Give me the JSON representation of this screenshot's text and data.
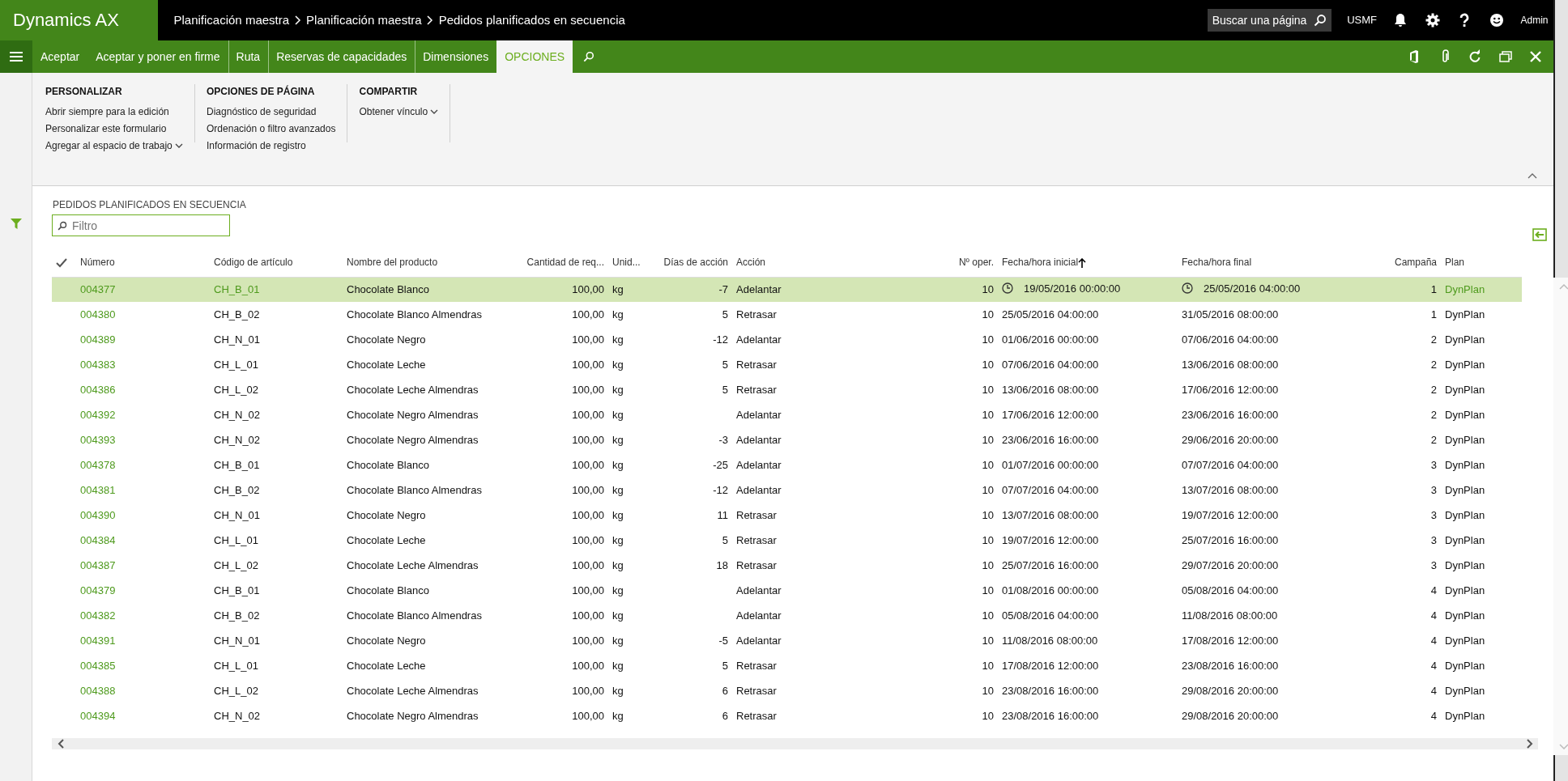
{
  "app": {
    "title": "Dynamics AX"
  },
  "breadcrumb": [
    "Planificación maestra",
    "Planificación maestra",
    "Pedidos planificados en secuencia"
  ],
  "search": {
    "placeholder": "Buscar una página"
  },
  "company": "USMF",
  "user": "Admin",
  "actions": [
    {
      "label": "Aceptar",
      "separator_before": false,
      "selected": false
    },
    {
      "label": "Aceptar y poner en firme",
      "separator_before": false,
      "selected": false
    },
    {
      "label": "Ruta",
      "separator_before": true,
      "selected": false
    },
    {
      "label": "Reservas de capacidades",
      "separator_before": true,
      "selected": false
    },
    {
      "label": "Dimensiones",
      "separator_before": true,
      "selected": false
    },
    {
      "label": "OPCIONES",
      "separator_before": false,
      "selected": true
    }
  ],
  "option_groups": [
    {
      "title": "PERSONALIZAR",
      "items": [
        {
          "label": "Abrir siempre para la edición",
          "dropdown": false
        },
        {
          "label": "Personalizar este formulario",
          "dropdown": false
        },
        {
          "label": "Agregar al espacio de trabajo",
          "dropdown": true
        }
      ]
    },
    {
      "title": "OPCIONES DE PÁGINA",
      "items": [
        {
          "label": "Diagnóstico de seguridad",
          "dropdown": false
        },
        {
          "label": "Ordenación o filtro avanzados",
          "dropdown": false
        },
        {
          "label": "Información de registro",
          "dropdown": false
        }
      ]
    },
    {
      "title": "COMPARTIR",
      "items": [
        {
          "label": "Obtener vínculo",
          "dropdown": true
        }
      ]
    }
  ],
  "grid": {
    "title": "PEDIDOS PLANIFICADOS EN SECUENCIA",
    "filter": {
      "placeholder": "Filtro"
    },
    "columns": [
      {
        "label": "Número",
        "sorted": false
      },
      {
        "label": "Código de artículo",
        "sorted": false
      },
      {
        "label": "Nombre del producto",
        "sorted": false
      },
      {
        "label": "Cantidad de req...",
        "sorted": false
      },
      {
        "label": "Unid...",
        "sorted": false
      },
      {
        "label": "Días de acción",
        "sorted": false
      },
      {
        "label": "Acción",
        "sorted": false
      },
      {
        "label": "Nº oper.",
        "sorted": false
      },
      {
        "label": "Fecha/hora inicial",
        "sorted": true
      },
      {
        "label": "Fecha/hora final",
        "sorted": false
      },
      {
        "label": "Campaña",
        "sorted": false
      },
      {
        "label": "Plan",
        "sorted": false
      }
    ],
    "rows": [
      {
        "selected": true,
        "cells": [
          "004377",
          "CH_B_01",
          "Chocolate Blanco",
          "100,00",
          "kg",
          "-7",
          "Adelantar",
          "10",
          "19/05/2016 00:00:00",
          "25/05/2016 04:00:00",
          "1",
          "DynPlan"
        ]
      },
      {
        "selected": false,
        "cells": [
          "004380",
          "CH_B_02",
          "Chocolate Blanco Almendras",
          "100,00",
          "kg",
          "5",
          "Retrasar",
          "10",
          "25/05/2016 04:00:00",
          "31/05/2016 08:00:00",
          "1",
          "DynPlan"
        ]
      },
      {
        "selected": false,
        "cells": [
          "004389",
          "CH_N_01",
          "Chocolate Negro",
          "100,00",
          "kg",
          "-12",
          "Adelantar",
          "10",
          "01/06/2016 00:00:00",
          "07/06/2016 04:00:00",
          "2",
          "DynPlan"
        ]
      },
      {
        "selected": false,
        "cells": [
          "004383",
          "CH_L_01",
          "Chocolate Leche",
          "100,00",
          "kg",
          "5",
          "Retrasar",
          "10",
          "07/06/2016 04:00:00",
          "13/06/2016 08:00:00",
          "2",
          "DynPlan"
        ]
      },
      {
        "selected": false,
        "cells": [
          "004386",
          "CH_L_02",
          "Chocolate Leche Almendras",
          "100,00",
          "kg",
          "5",
          "Retrasar",
          "10",
          "13/06/2016 08:00:00",
          "17/06/2016 12:00:00",
          "2",
          "DynPlan"
        ]
      },
      {
        "selected": false,
        "cells": [
          "004392",
          "CH_N_02",
          "Chocolate Negro Almendras",
          "100,00",
          "kg",
          null,
          "Adelantar",
          "10",
          "17/06/2016 12:00:00",
          "23/06/2016 16:00:00",
          "2",
          "DynPlan"
        ]
      },
      {
        "selected": false,
        "cells": [
          "004393",
          "CH_N_02",
          "Chocolate Negro Almendras",
          "100,00",
          "kg",
          "-3",
          "Adelantar",
          "10",
          "23/06/2016 16:00:00",
          "29/06/2016 20:00:00",
          "2",
          "DynPlan"
        ]
      },
      {
        "selected": false,
        "cells": [
          "004378",
          "CH_B_01",
          "Chocolate Blanco",
          "100,00",
          "kg",
          "-25",
          "Adelantar",
          "10",
          "01/07/2016 00:00:00",
          "07/07/2016 04:00:00",
          "3",
          "DynPlan"
        ]
      },
      {
        "selected": false,
        "cells": [
          "004381",
          "CH_B_02",
          "Chocolate Blanco Almendras",
          "100,00",
          "kg",
          "-12",
          "Adelantar",
          "10",
          "07/07/2016 04:00:00",
          "13/07/2016 08:00:00",
          "3",
          "DynPlan"
        ]
      },
      {
        "selected": false,
        "cells": [
          "004390",
          "CH_N_01",
          "Chocolate Negro",
          "100,00",
          "kg",
          "11",
          "Retrasar",
          "10",
          "13/07/2016 08:00:00",
          "19/07/2016 12:00:00",
          "3",
          "DynPlan"
        ]
      },
      {
        "selected": false,
        "cells": [
          "004384",
          "CH_L_01",
          "Chocolate Leche",
          "100,00",
          "kg",
          "5",
          "Retrasar",
          "10",
          "19/07/2016 12:00:00",
          "25/07/2016 16:00:00",
          "3",
          "DynPlan"
        ]
      },
      {
        "selected": false,
        "cells": [
          "004387",
          "CH_L_02",
          "Chocolate Leche Almendras",
          "100,00",
          "kg",
          "18",
          "Retrasar",
          "10",
          "25/07/2016 16:00:00",
          "29/07/2016 20:00:00",
          "3",
          "DynPlan"
        ]
      },
      {
        "selected": false,
        "cells": [
          "004379",
          "CH_B_01",
          "Chocolate Blanco",
          "100,00",
          "kg",
          null,
          "Adelantar",
          "10",
          "01/08/2016 00:00:00",
          "05/08/2016 04:00:00",
          "4",
          "DynPlan"
        ]
      },
      {
        "selected": false,
        "cells": [
          "004382",
          "CH_B_02",
          "Chocolate Blanco Almendras",
          "100,00",
          "kg",
          null,
          "Adelantar",
          "10",
          "05/08/2016 04:00:00",
          "11/08/2016 08:00:00",
          "4",
          "DynPlan"
        ]
      },
      {
        "selected": false,
        "cells": [
          "004391",
          "CH_N_01",
          "Chocolate Negro",
          "100,00",
          "kg",
          "-5",
          "Adelantar",
          "10",
          "11/08/2016 08:00:00",
          "17/08/2016 12:00:00",
          "4",
          "DynPlan"
        ]
      },
      {
        "selected": false,
        "cells": [
          "004385",
          "CH_L_01",
          "Chocolate Leche",
          "100,00",
          "kg",
          "5",
          "Retrasar",
          "10",
          "17/08/2016 12:00:00",
          "23/08/2016 16:00:00",
          "4",
          "DynPlan"
        ]
      },
      {
        "selected": false,
        "cells": [
          "004388",
          "CH_L_02",
          "Chocolate Leche Almendras",
          "100,00",
          "kg",
          "6",
          "Retrasar",
          "10",
          "23/08/2016 16:00:00",
          "29/08/2016 20:00:00",
          "4",
          "DynPlan"
        ]
      },
      {
        "selected": false,
        "cells": [
          "004394",
          "CH_N_02",
          "Chocolate Negro Almendras",
          "100,00",
          "kg",
          "6",
          "Retrasar",
          "10",
          "23/08/2016 16:00:00",
          "29/08/2016 20:00:00",
          "4",
          "DynPlan"
        ]
      }
    ]
  }
}
